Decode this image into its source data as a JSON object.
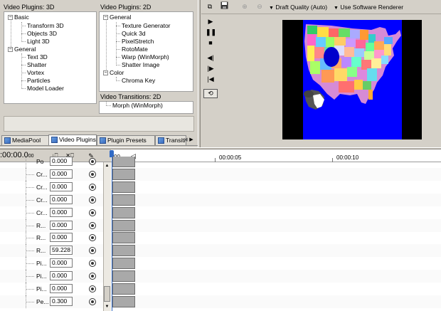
{
  "panels": {
    "plugins3d": {
      "header": "Video Plugins: 3D",
      "groups": [
        {
          "name": "Basic",
          "items": [
            "Transform 3D",
            "Objects 3D",
            "Light 3D"
          ]
        },
        {
          "name": "General",
          "items": [
            "Text 3D",
            "Shatter",
            "Vortex",
            "Particles",
            "Model Loader"
          ]
        }
      ]
    },
    "plugins2d": {
      "header": "Video Plugins: 2D",
      "groups": [
        {
          "name": "General",
          "items": [
            "Texture Generator",
            "Quick 3d",
            "PixelStretch",
            "RotoMate",
            "Warp (WinMorph)",
            "Shatter Image"
          ]
        },
        {
          "name": "Color",
          "items": [
            "Chroma Key"
          ]
        }
      ]
    },
    "transitions2d": {
      "header": "Video Transitions: 2D",
      "items": [
        "Morph (WinMorph)"
      ]
    }
  },
  "tabs": [
    "MediaPool",
    "Video Plugins",
    "Plugin Presets",
    "Transitic"
  ],
  "preview_toolbar": {
    "quality_label": "Draft Quality (Auto)",
    "renderer_label": "Use Software Renderer"
  },
  "timeline": {
    "timecode": ":00:00.0",
    "timecode_suffix": "00",
    "ruler_start": "00",
    "ruler_marks": [
      "00:00:05",
      "00:00:10"
    ]
  },
  "params": [
    {
      "label": "Po",
      "value": "0.000"
    },
    {
      "label": "Cr...",
      "value": "0.000"
    },
    {
      "label": "Cr...",
      "value": "0.000"
    },
    {
      "label": "Cr...",
      "value": "0.000"
    },
    {
      "label": "Cr...",
      "value": "0.000"
    },
    {
      "label": "R...",
      "value": "0.000"
    },
    {
      "label": "R...",
      "value": "0.000"
    },
    {
      "label": "R...",
      "value": "59.228"
    },
    {
      "label": "Pi...",
      "value": "0.000"
    },
    {
      "label": "Pi...",
      "value": "0.000"
    },
    {
      "label": "Pi...",
      "value": "0.000"
    },
    {
      "label": "Pe...",
      "value": "0.300"
    }
  ],
  "colors": {
    "window_bg": "#d4d0c8",
    "preview_bg": "#0000ff",
    "timeline_bg": "#ffffff",
    "accent": "#316ac5"
  },
  "icons": {
    "copy": "copy-icon",
    "save": "save-icon",
    "zoom_in": "zoom-in-icon",
    "zoom_out": "zoom-out-icon",
    "play": "play-icon",
    "pause": "pause-icon",
    "stop": "stop-icon"
  }
}
